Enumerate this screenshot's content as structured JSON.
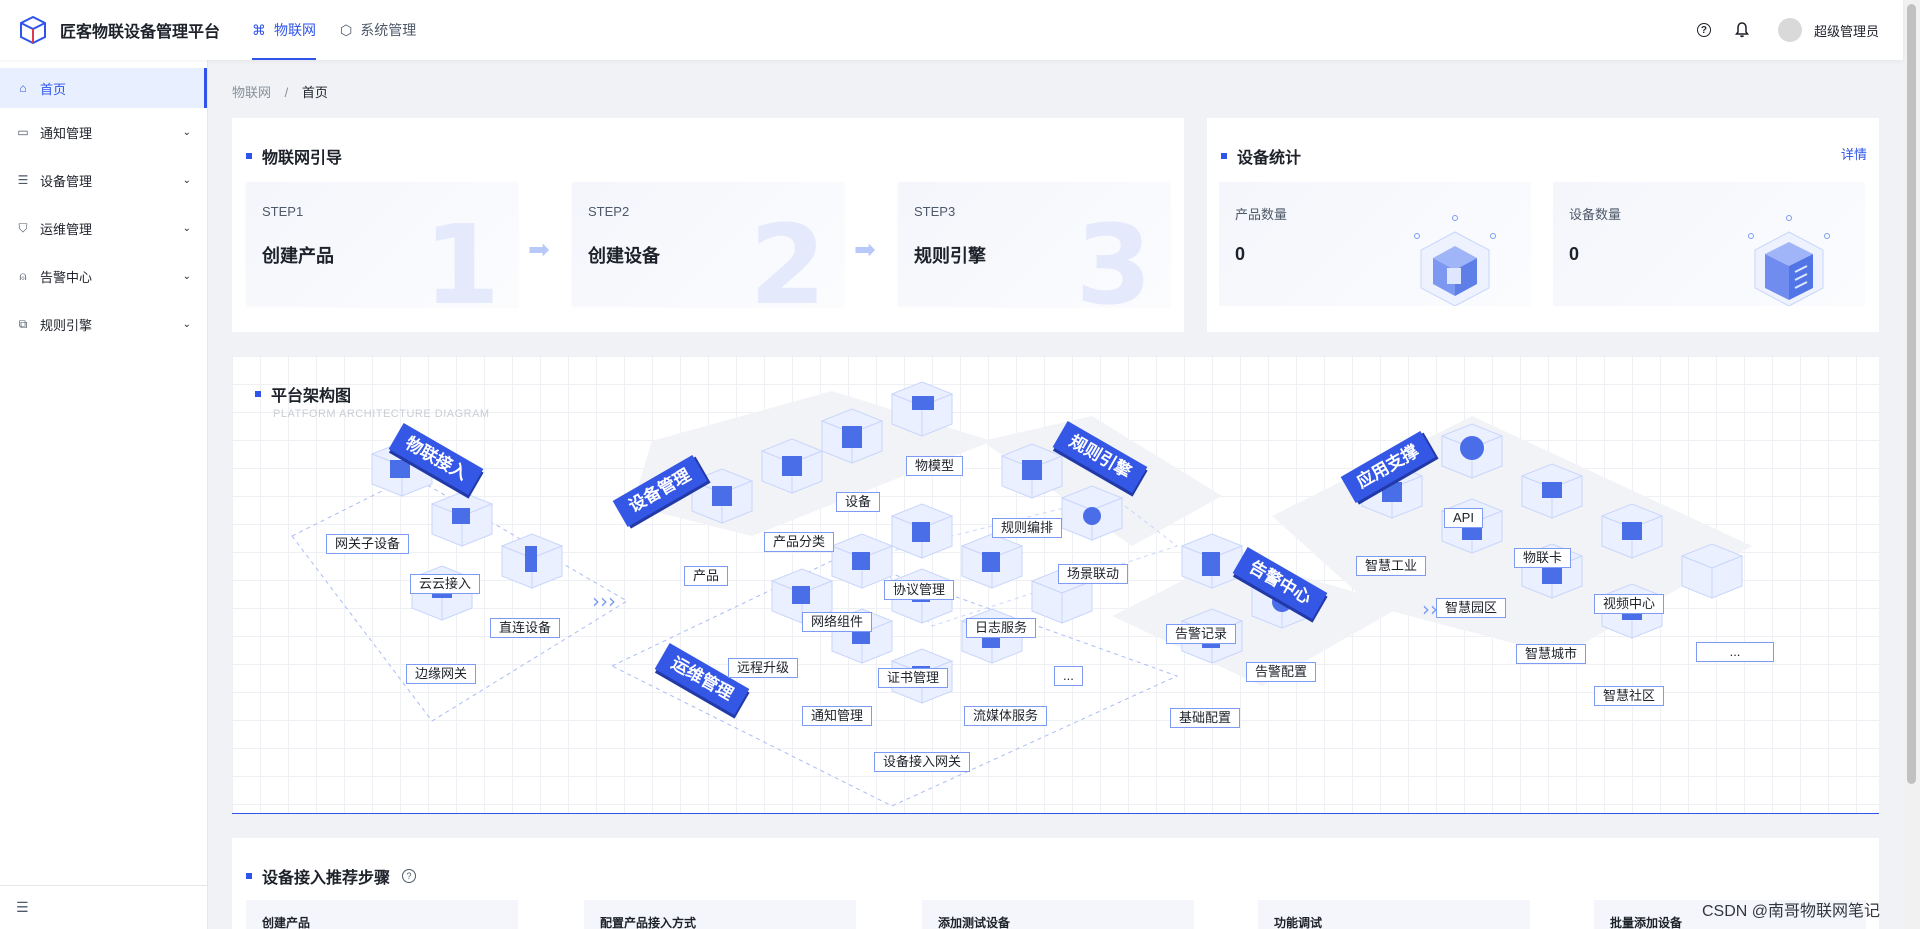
{
  "app": {
    "title": "匠客物联设备管理平台"
  },
  "top_nav": [
    {
      "label": "物联网",
      "icon": "iot-icon",
      "active": true
    },
    {
      "label": "系统管理",
      "icon": "cube-icon",
      "active": false
    }
  ],
  "user": {
    "name": "超级管理员"
  },
  "sidebar": {
    "items": [
      {
        "label": "首页",
        "icon": "home-icon",
        "active": true
      },
      {
        "label": "通知管理",
        "icon": "notification-icon"
      },
      {
        "label": "设备管理",
        "icon": "device-icon"
      },
      {
        "label": "运维管理",
        "icon": "maintenance-icon"
      },
      {
        "label": "告警中心",
        "icon": "alarm-icon"
      },
      {
        "label": "规则引擎",
        "icon": "rule-icon"
      }
    ]
  },
  "breadcrumb": {
    "parent": "物联网",
    "separator": "/",
    "current": "首页"
  },
  "guide": {
    "title": "物联网引导",
    "steps": [
      {
        "label": "STEP1",
        "title": "创建产品",
        "num": "1"
      },
      {
        "label": "STEP2",
        "title": "创建设备",
        "num": "2"
      },
      {
        "label": "STEP3",
        "title": "规则引擎",
        "num": "3"
      }
    ]
  },
  "stats": {
    "title": "设备统计",
    "link": "详情",
    "items": [
      {
        "label": "产品数量",
        "value": "0"
      },
      {
        "label": "设备数量",
        "value": "0"
      }
    ]
  },
  "arch": {
    "title": "平台架构图",
    "subtitle": "PLATFORM ARCHITECTURE DIAGRAM",
    "banners": {
      "access": "物联接入",
      "device": "设备管理",
      "rule": "规则引擎",
      "ops": "运维管理",
      "alarm": "告警中心",
      "app": "应用支撑"
    },
    "labels": {
      "gateway_sub": "网关子设备",
      "cloud": "云云接入",
      "direct": "直连设备",
      "edge": "边缘网关",
      "product": "产品",
      "category": "产品分类",
      "device": "设备",
      "model": "物模型",
      "rule_edit": "规则编排",
      "scene": "场景联动",
      "protocol": "协议管理",
      "network": "网络组件",
      "log": "日志服务",
      "ota": "远程升级",
      "cert": "证书管理",
      "more1": "...",
      "notice": "通知管理",
      "stream": "流媒体服务",
      "gw_access": "设备接入网关",
      "alarm_record": "告警记录",
      "alarm_config": "告警配置",
      "base_config": "基础配置",
      "api": "API",
      "industry": "智慧工业",
      "iot_card": "物联卡",
      "park": "智慧园区",
      "video": "视频中心",
      "city": "智慧城市",
      "community": "智慧社区",
      "more2": "..."
    }
  },
  "recommend": {
    "title": "设备接入推荐步骤",
    "steps": [
      "创建产品",
      "配置产品接入方式",
      "添加测试设备",
      "功能调试",
      "批量添加设备"
    ]
  },
  "watermark": "CSDN @南哥物联网笔记",
  "colors": {
    "primary": "#2f54eb",
    "banner": "#3457e5",
    "label_border": "#7d9bf5"
  }
}
